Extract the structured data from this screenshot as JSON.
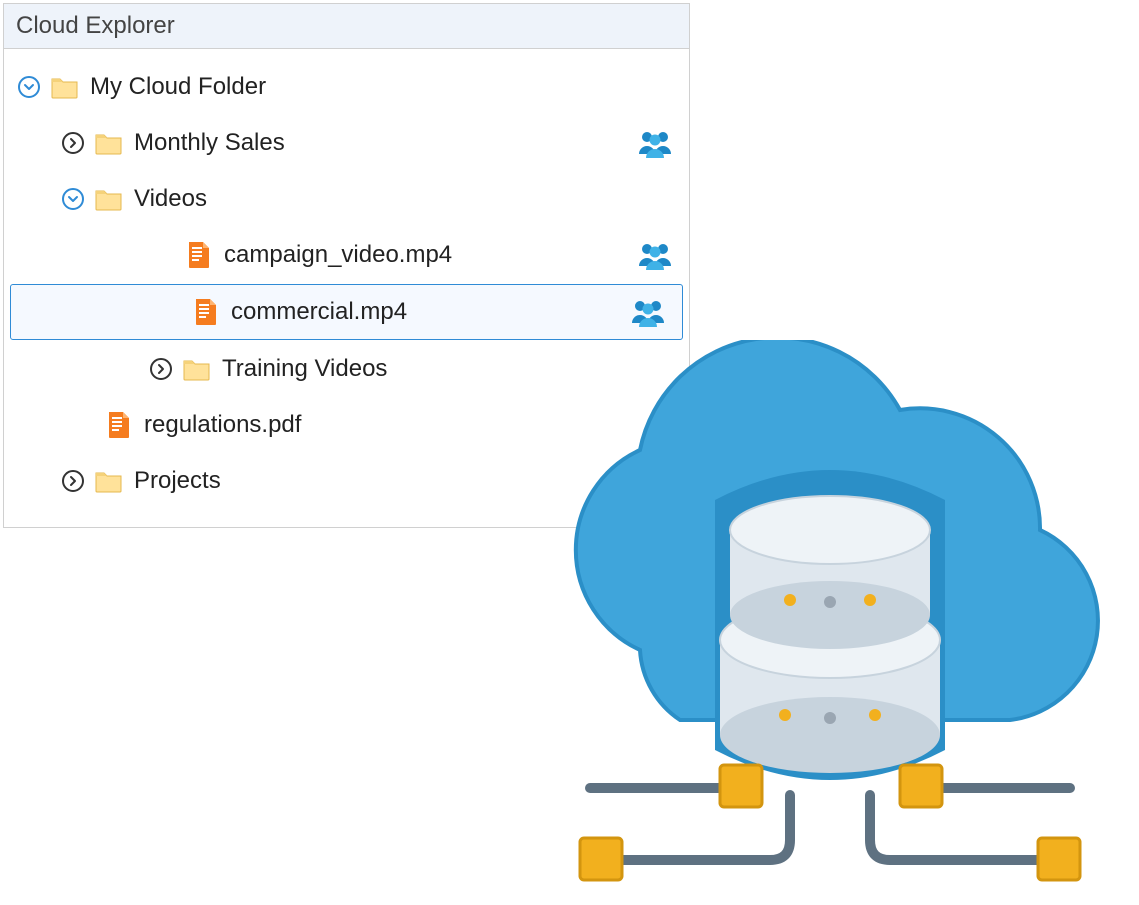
{
  "panel": {
    "title": "Cloud Explorer"
  },
  "tree": {
    "root": {
      "label": "My Cloud Folder",
      "expanded": true,
      "children": [
        {
          "label": "Monthly Sales",
          "type": "folder",
          "expanded": false,
          "shared": true
        },
        {
          "label": "Videos",
          "type": "folder",
          "expanded": true,
          "children": [
            {
              "label": "campaign_video.mp4",
              "type": "file",
              "shared": true
            },
            {
              "label": "commercial.mp4",
              "type": "file",
              "shared": true,
              "selected": true
            },
            {
              "label": "Training Videos",
              "type": "folder",
              "expanded": false
            }
          ]
        },
        {
          "label": "regulations.pdf",
          "type": "file"
        },
        {
          "label": "Projects",
          "type": "folder",
          "expanded": false
        }
      ]
    }
  }
}
